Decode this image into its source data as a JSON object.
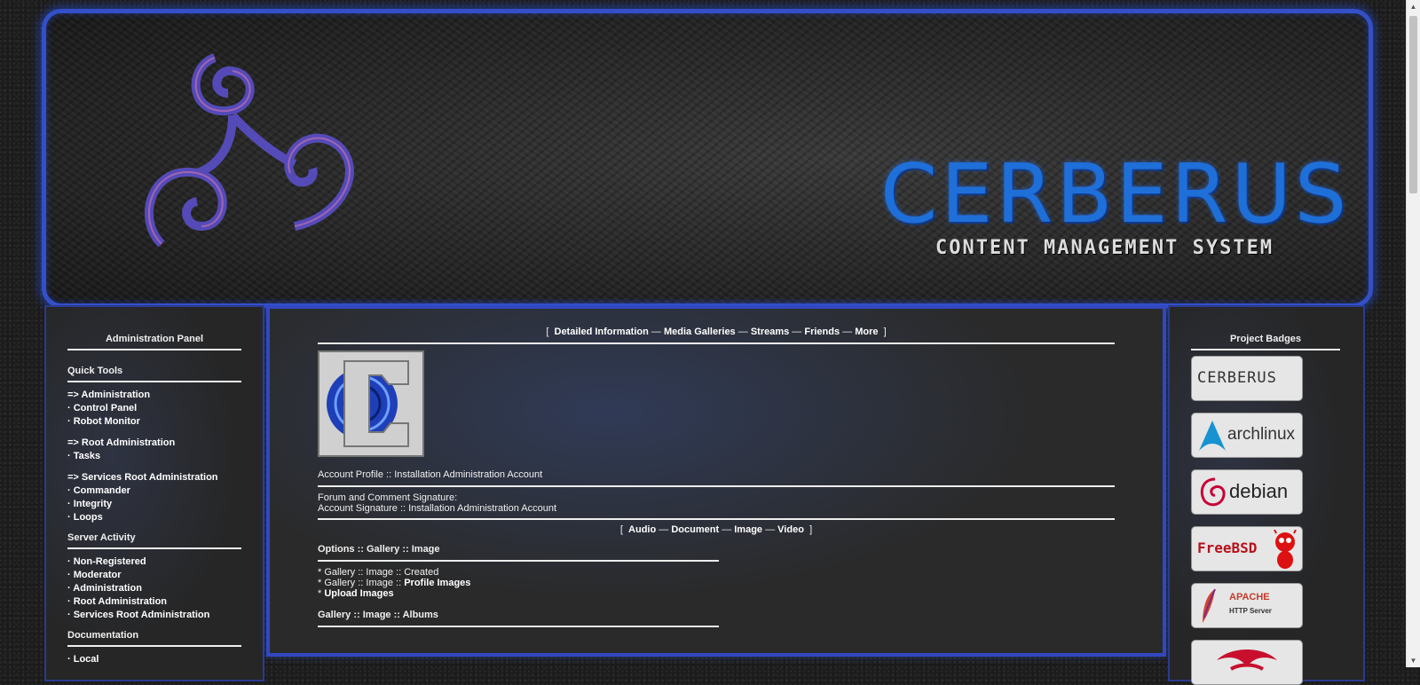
{
  "banner": {
    "title": "CERBERUS",
    "subtitle": "CONTENT MANAGEMENT SYSTEM"
  },
  "left": {
    "title": "Administration Panel",
    "quick_tools": "Quick Tools",
    "group1": [
      "=> Administration",
      "· Control Panel",
      "· Robot Monitor"
    ],
    "group2": [
      "=> Root Administration",
      "· Tasks"
    ],
    "group3": [
      "=> Services Root Administration",
      "· Commander",
      "· Integrity",
      "· Loops"
    ],
    "server_activity": "Server Activity",
    "group4": [
      "· Non-Registered",
      "· Moderator",
      "· Administration",
      "· Root Administration",
      "· Services Root Administration"
    ],
    "documentation": "Documentation",
    "group5": [
      "· Local"
    ]
  },
  "main": {
    "nav_open": "[",
    "nav_close": "]",
    "dash": "—",
    "nav": [
      "Detailed Information",
      "Media Galleries",
      "Streams",
      "Friends",
      "More"
    ],
    "profile_line": "Account Profile :: Installation Administration Account",
    "signature_label": "Forum and Comment Signature:",
    "signature_text": "Account Signature :: Installation Administration Account",
    "media_nav": [
      "Audio",
      "Document",
      "Image",
      "Video"
    ],
    "options_title": "Options :: Gallery :: Image",
    "opt1": "* Gallery :: Image :: Created",
    "opt2_prefix": "* Gallery :: Image :: ",
    "opt2_link": "Profile Images",
    "opt3_prefix": "* ",
    "opt3_link": "Upload Images",
    "albums_title": "Gallery :: Image :: Albums"
  },
  "right": {
    "title": "Project Badges",
    "badges": [
      "CERBERUS",
      "archlinux",
      "debian",
      "FreeBSD",
      "APACHE",
      "HTTP Server"
    ]
  },
  "colors": {
    "accent": "#3350c8",
    "banner_title": "#1f6fd8"
  }
}
